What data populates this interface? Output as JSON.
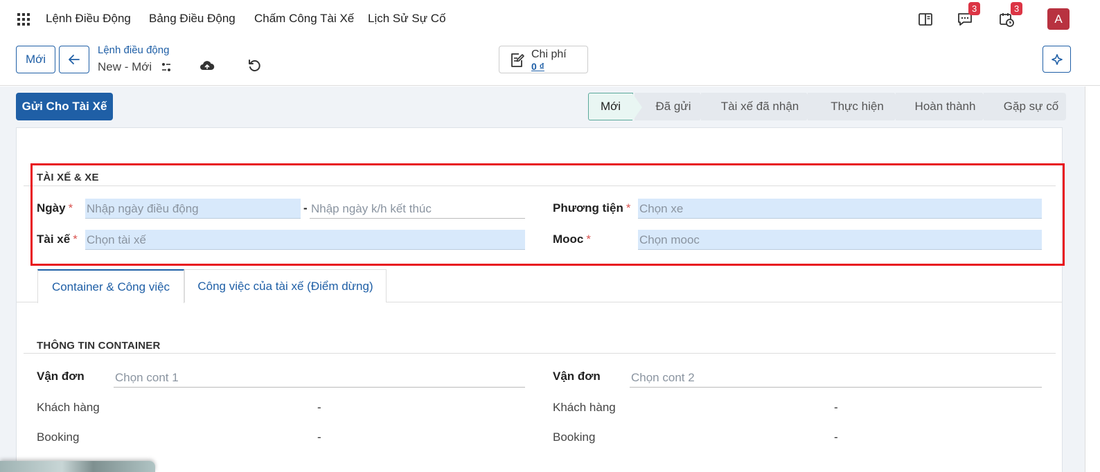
{
  "nav": {
    "items": [
      "Lệnh Điều Động",
      "Bảng Điều Động",
      "Chấm Công Tài Xế",
      "Lịch Sử Sự Cố"
    ],
    "messages_badge": "3",
    "activities_badge": "3",
    "avatar_initial": "A"
  },
  "control": {
    "new_button": "Mới",
    "breadcrumb_parent": "Lệnh điều động",
    "breadcrumb_current": "New - Mới",
    "stat_label": "Chi phí",
    "stat_value": "0 ₫"
  },
  "actions": {
    "send_driver": "Gửi Cho Tài Xế"
  },
  "status_stages": [
    "Mới",
    "Đã gửi",
    "Tài xế đã nhận",
    "Thực hiện",
    "Hoàn thành",
    "Gặp sự cố"
  ],
  "driver_section": {
    "title": "TÀI XẾ & XE",
    "date_label": "Ngày",
    "date_start_placeholder": "Nhập ngày điều động",
    "date_separator": "-",
    "date_end_placeholder": "Nhập ngày k/h kết thúc",
    "vehicle_label": "Phương tiện",
    "vehicle_placeholder": "Chọn xe",
    "driver_label": "Tài xế",
    "driver_placeholder": "Chọn tài xế",
    "trailer_label": "Mooc",
    "trailer_placeholder": "Chọn mooc",
    "required_mark": "*"
  },
  "tabs": [
    "Container & Công việc",
    "Công việc của tài xế (Điểm dừng)"
  ],
  "container_section": {
    "title": "THÔNG TIN CONTAINER",
    "left": {
      "bill_label": "Vận đơn",
      "bill_placeholder": "Chọn cont 1",
      "customer_label": "Khách hàng",
      "customer_value": "-",
      "booking_label": "Booking",
      "booking_value": "-"
    },
    "right": {
      "bill_label": "Vận đơn",
      "bill_placeholder": "Chọn cont 2",
      "customer_label": "Khách hàng",
      "customer_value": "-",
      "booking_label": "Booking",
      "booking_value": "-"
    }
  },
  "colors": {
    "primary": "#1f5fa6",
    "highlight": "#e8121d",
    "badge": "#dc3545",
    "avatar": "#b83240",
    "input_required_bg": "#d8e9fb"
  }
}
